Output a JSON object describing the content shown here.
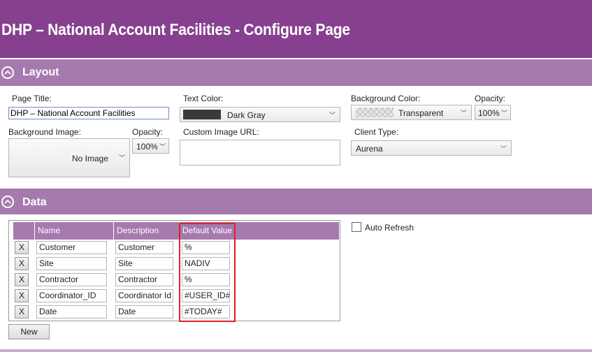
{
  "page": {
    "title": "DHP – National Account Facilities - Configure Page"
  },
  "layout_section": {
    "label": "Layout",
    "page_title_label": "Page Title:",
    "page_title_value": "DHP – National Account Facilities",
    "text_color_label": "Text Color:",
    "text_color_value": "Dark Gray",
    "text_color_swatch": "#3a3a3a",
    "background_color_label": "Background Color:",
    "background_color_value": "Transparent",
    "opacity_label": "Opacity:",
    "bg_color_opacity_value": "100%",
    "background_image_label": "Background Image:",
    "background_image_value": "No Image",
    "bg_image_opacity_label": "Opacity:",
    "bg_image_opacity_value": "100%",
    "custom_image_url_label": "Custom Image URL:",
    "custom_image_url_value": "",
    "client_type_label": "Client Type:",
    "client_type_value": "Aurena"
  },
  "data_section": {
    "label": "Data",
    "columns": [
      "Name",
      "Description",
      "Default Value"
    ],
    "remove_label": "X",
    "rows": [
      {
        "name": "Customer",
        "description": "Customer",
        "default_value": "%"
      },
      {
        "name": "Site",
        "description": "Site",
        "default_value": "NADIV"
      },
      {
        "name": "Contractor",
        "description": "Contractor",
        "default_value": "%"
      },
      {
        "name": "Coordinator_ID",
        "description": "Coordinator Id",
        "default_value": "#USER_ID#"
      },
      {
        "name": "Date",
        "description": "Date",
        "default_value": "#TODAY#"
      }
    ],
    "new_button_label": "New",
    "auto_refresh_label": "Auto Refresh",
    "auto_refresh_checked": false
  },
  "colors": {
    "title_bar": "#86408f",
    "section_bar": "#a67aae",
    "highlight": "#e02020"
  },
  "icons": {
    "collapse": "chevron-up-circle-icon",
    "dropdown": "chevron-down-icon"
  }
}
